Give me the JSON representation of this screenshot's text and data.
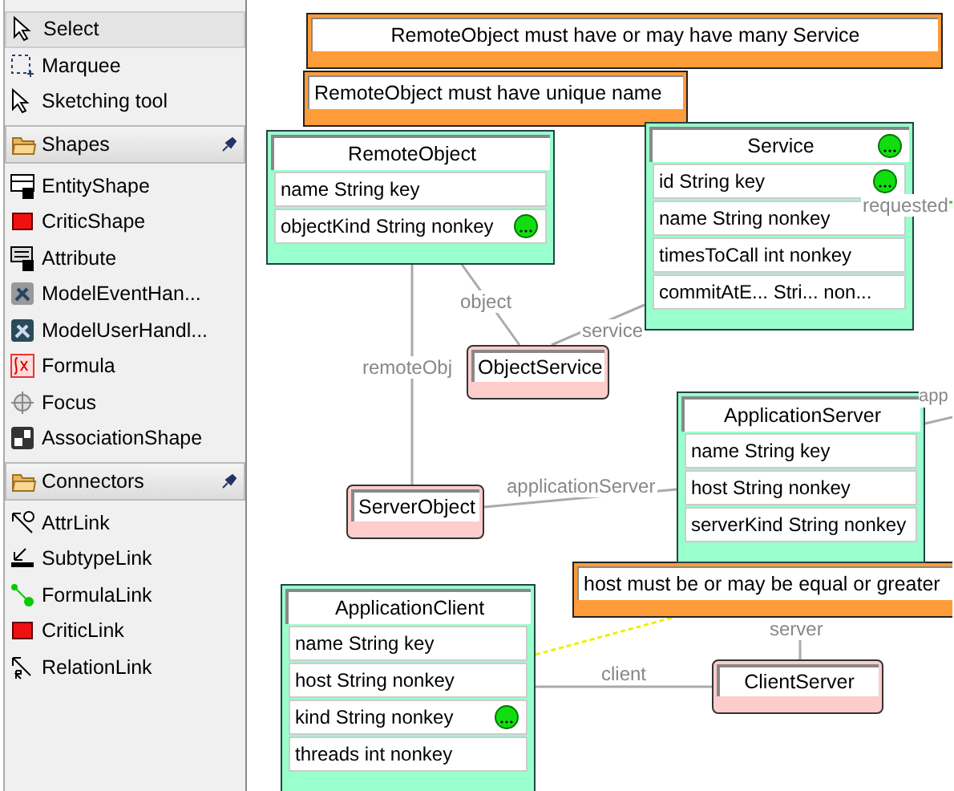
{
  "palette": {
    "tools": [
      {
        "label": "Select",
        "selected": true
      },
      {
        "label": "Marquee",
        "selected": false
      },
      {
        "label": "Sketching tool",
        "selected": false
      }
    ],
    "sections": [
      {
        "title": "Shapes",
        "items": [
          {
            "label": "EntityShape"
          },
          {
            "label": "CriticShape"
          },
          {
            "label": "Attribute"
          },
          {
            "label": "ModelEventHan..."
          },
          {
            "label": "ModelUserHandl..."
          },
          {
            "label": "Formula"
          },
          {
            "label": "Focus"
          },
          {
            "label": "AssociationShape"
          }
        ]
      },
      {
        "title": "Connectors",
        "items": [
          {
            "label": "AttrLink"
          },
          {
            "label": "SubtypeLink"
          },
          {
            "label": "FormulaLink"
          },
          {
            "label": "CriticLink"
          },
          {
            "label": "RelationLink"
          }
        ]
      }
    ]
  },
  "diagram": {
    "constraints": [
      {
        "text": "RemoteObject must have or may have many Service"
      },
      {
        "text": "RemoteObject must have unique name"
      },
      {
        "text": "host must be or may be equal or greater"
      }
    ],
    "entities": [
      {
        "name": "RemoteObject",
        "critic": false,
        "attributes": [
          {
            "text": "name String key",
            "critic": false
          },
          {
            "text": "objectKind String nonkey",
            "critic": true
          }
        ]
      },
      {
        "name": "Service",
        "critic": true,
        "attributes": [
          {
            "text": "id String key",
            "critic": true
          },
          {
            "text": "name String nonkey",
            "critic": false
          },
          {
            "text": "timesToCall int nonkey",
            "critic": false
          },
          {
            "text": "commitAtE... Stri...  non...",
            "critic": false
          }
        ]
      },
      {
        "name": "ApplicationServer",
        "critic": false,
        "attributes": [
          {
            "text": "name String key",
            "critic": false
          },
          {
            "text": "host String nonkey",
            "critic": false
          },
          {
            "text": "serverKind String nonkey",
            "critic": false
          }
        ]
      },
      {
        "name": "ApplicationClient",
        "critic": false,
        "attributes": [
          {
            "text": "name String key",
            "critic": false
          },
          {
            "text": "host String nonkey",
            "critic": false
          },
          {
            "text": "kind String nonkey",
            "critic": true
          },
          {
            "text": "threads int nonkey",
            "critic": false
          }
        ]
      }
    ],
    "relationships": [
      {
        "name": "ObjectService"
      },
      {
        "name": "ServerObject"
      },
      {
        "name": "ClientServer"
      }
    ],
    "edge_labels": [
      {
        "text": "object"
      },
      {
        "text": "service"
      },
      {
        "text": "requested"
      },
      {
        "text": "remoteObj"
      },
      {
        "text": "applicationServer"
      },
      {
        "text": "app"
      },
      {
        "text": "server"
      },
      {
        "text": "client"
      }
    ]
  }
}
